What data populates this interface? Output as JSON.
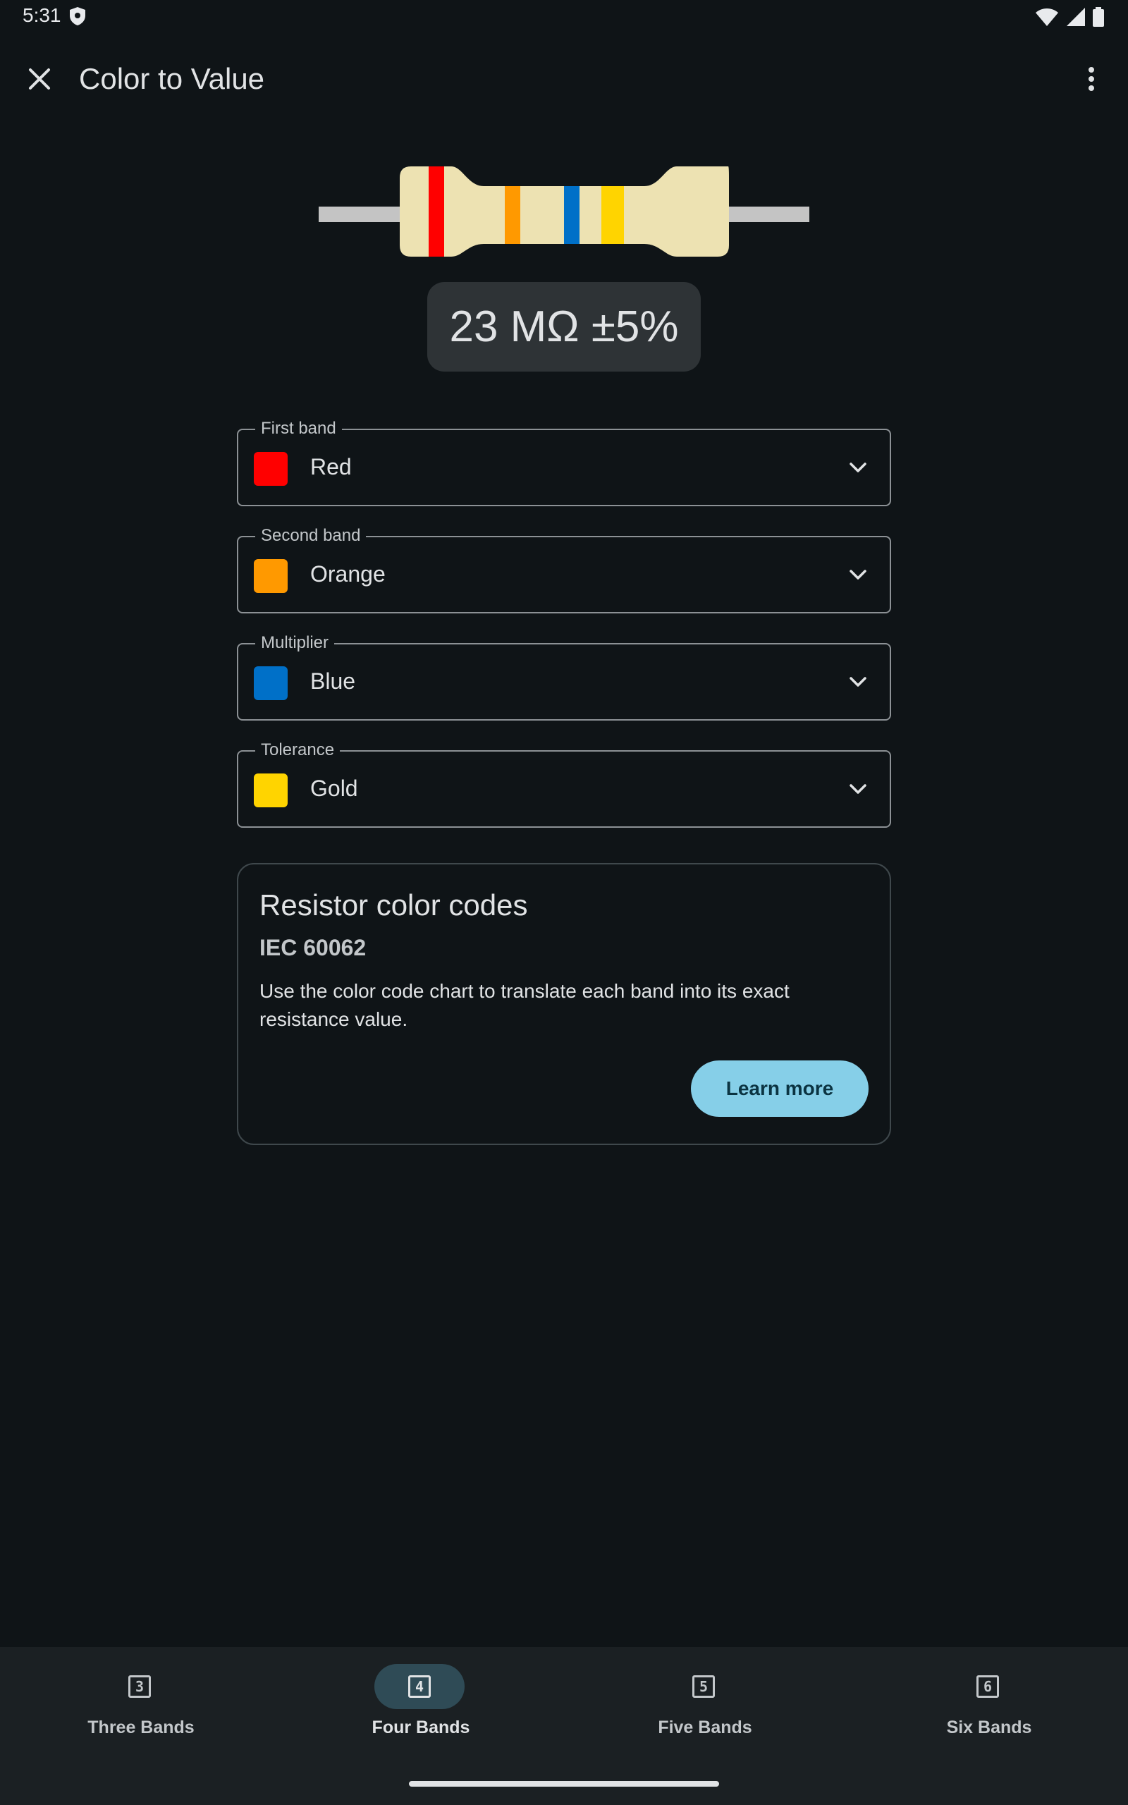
{
  "status_bar": {
    "time": "5:31"
  },
  "app_bar": {
    "title": "Color to Value"
  },
  "resistor": {
    "body_color": "#ede2b2",
    "lead_color": "#c4c4c4",
    "bands": [
      "#ff0000",
      "#ff9900",
      "#0070c8",
      "#ffd400"
    ]
  },
  "result": {
    "value_text": "23 MΩ ±5%"
  },
  "fields": [
    {
      "label": "First band",
      "value": "Red",
      "color": "#ff0000"
    },
    {
      "label": "Second band",
      "value": "Orange",
      "color": "#ff9900"
    },
    {
      "label": "Multiplier",
      "value": "Blue",
      "color": "#0070c8"
    },
    {
      "label": "Tolerance",
      "value": "Gold",
      "color": "#ffd400"
    }
  ],
  "card": {
    "title": "Resistor color codes",
    "subtitle": "IEC 60062",
    "body": "Use the color code chart to translate each band into its exact resistance value.",
    "button": "Learn more"
  },
  "nav": {
    "items": [
      {
        "icon_text": "3",
        "label": "Three Bands",
        "active": false
      },
      {
        "icon_text": "4",
        "label": "Four Bands",
        "active": true
      },
      {
        "icon_text": "5",
        "label": "Five Bands",
        "active": false
      },
      {
        "icon_text": "6",
        "label": "Six Bands",
        "active": false
      }
    ]
  }
}
